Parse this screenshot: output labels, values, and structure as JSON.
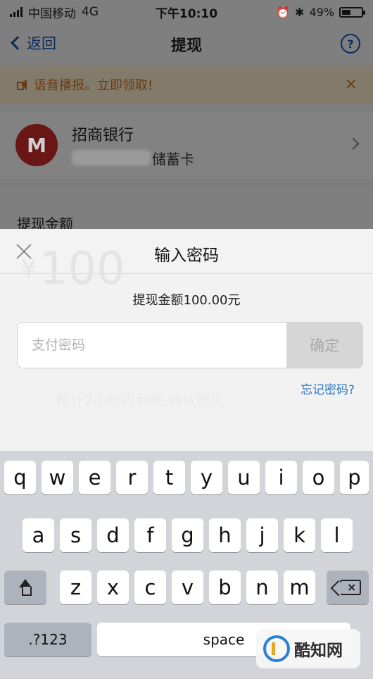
{
  "status_bar": {
    "carrier": "中国移动",
    "network": "4G",
    "time": "下午10:10",
    "battery": "49%"
  },
  "nav": {
    "back": "返回",
    "title": "提现",
    "help_icon": "question-circle-icon"
  },
  "notice": {
    "text": "语音播报。立即领取!",
    "close": "×"
  },
  "bank": {
    "name": "招商银行",
    "card_suffix": "储蓄卡",
    "logo_text": "M"
  },
  "amount_label": "提现金额",
  "ghost_amount": "100",
  "ghost_currency": "¥",
  "modal": {
    "title": "输入密码",
    "amount_text": "提现金额100.00元",
    "placeholder": "支付密码",
    "confirm": "确定",
    "forgot": "忘记密码?",
    "ghost_submit": "预计2小时内到账,确认提现"
  },
  "keyboard": {
    "row1": [
      "q",
      "w",
      "e",
      "r",
      "t",
      "y",
      "u",
      "i",
      "o",
      "p"
    ],
    "row2": [
      "a",
      "s",
      "d",
      "f",
      "g",
      "h",
      "j",
      "k",
      "l"
    ],
    "row3": [
      "z",
      "x",
      "c",
      "v",
      "b",
      "n",
      "m"
    ],
    "numbers_key": ".?123",
    "space": "space"
  },
  "watermark": {
    "text": "酷知网"
  }
}
